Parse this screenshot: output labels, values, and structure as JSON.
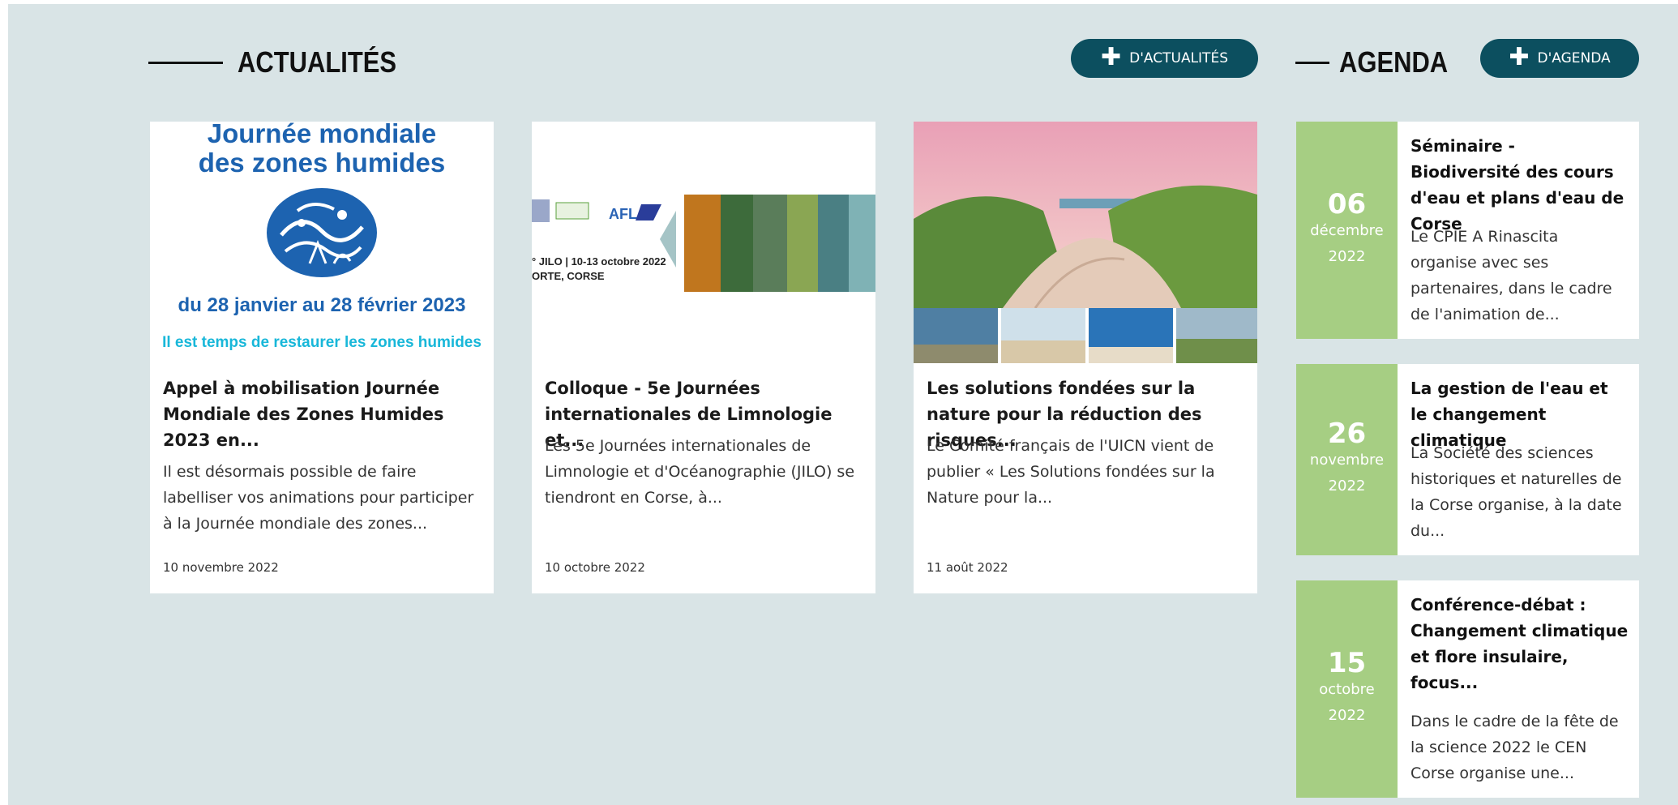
{
  "news": {
    "title": "ACTUALITÉS",
    "more_button": "D'ACTUALITÉS",
    "cards": [
      {
        "title": "Appel à mobilisation Journée Mondiale des Zones Humides 2023 en...",
        "excerpt": " Il est désormais possible de faire labelliser vos animations pour participer à la Journée mondiale des zones...",
        "date": "10 novembre 2022",
        "poster_title_1": "Journée mondiale",
        "poster_title_2": "des zones humides",
        "poster_dates": "du 28 janvier au 28 février 2023",
        "poster_tagline": "Il est temps de restaurer les zones humides"
      },
      {
        "title": "Colloque - 5e Journées internationales de Limnologie et...",
        "excerpt": "Les 5e Journées internationales de Limnologie et d'Océanographie (JILO) se tiendront en Corse, à...",
        "date": "10 octobre 2022",
        "banner_line_1": "° JILO | 10-13 octobre 2022",
        "banner_line_2": "ORTE, CORSE",
        "banner_logo": "AFL"
      },
      {
        "title": "Les solutions fondées sur la nature pour la réduction des risques...",
        "excerpt": "Le Comité français de l'UICN vient de publier « Les Solutions fondées sur la Nature pour la...",
        "date": "11 août 2022"
      }
    ]
  },
  "agenda": {
    "title": "AGENDA",
    "more_button": "D'AGENDA",
    "items": [
      {
        "day": "06",
        "month": "décembre",
        "year": "2022",
        "title": "Séminaire - Biodiversité des cours d'eau et plans d'eau de Corse",
        "excerpt": " Le CPIE A Rinascita organise avec ses partenaires, dans le cadre de l'animation de..."
      },
      {
        "day": "26",
        "month": "novembre",
        "year": "2022",
        "title": "La gestion de l'eau et le changement climatique",
        "excerpt": " La Société des sciences historiques et naturelles de la Corse organise, à la date du..."
      },
      {
        "day": "15",
        "month": "octobre",
        "year": "2022",
        "title": "Conférence-débat : Changement climatique et flore insulaire, focus...",
        "excerpt": " Dans le cadre de la fête de la science 2022 le CEN Corse organise une..."
      }
    ]
  },
  "colors": {
    "panel_bg": "#d9e4e6",
    "button_bg": "#0c4f5f",
    "date_box": "#a6ce83",
    "poster_blue": "#1d63b0",
    "poster_cyan": "#18b7d9"
  },
  "icons": {
    "more_button_icon": "plus-icon"
  }
}
